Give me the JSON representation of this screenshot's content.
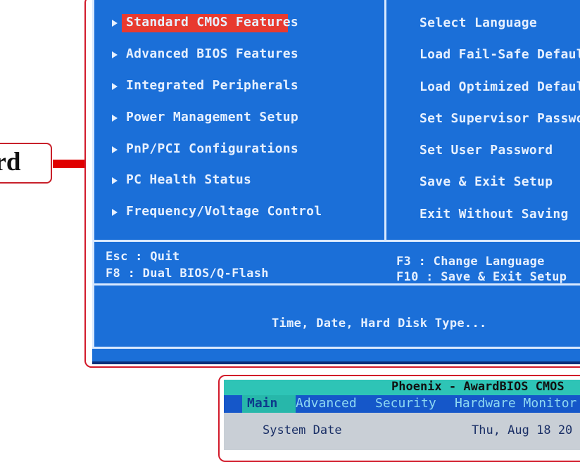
{
  "callout_label": "ard",
  "bios": {
    "left_menu": [
      "Standard CMOS Features",
      "Advanced BIOS Features",
      "Integrated Peripherals",
      "Power Management Setup",
      "PnP/PCI Configurations",
      "PC Health Status",
      "Frequency/Voltage Control"
    ],
    "right_menu": [
      "Select Language",
      "Load Fail-Safe Defaul",
      "Load Optimized Defaul",
      "Set Supervisor Passwor",
      "Set User Password",
      "Save & Exit Setup",
      "Exit Without Saving"
    ],
    "keys_left": [
      "Esc : Quit",
      "F8  : Dual BIOS/Q-Flash"
    ],
    "keys_right": [
      "F3  : Change Language",
      "F10 : Save & Exit Setup"
    ],
    "help_text": "Time, Date, Hard Disk Type...",
    "selected_index": 0,
    "colors": {
      "screen": "#1b6fd8",
      "selection": "#e83a2f",
      "text": "#e6f0ff"
    }
  },
  "bios2": {
    "title": "Phoenix - AwardBIOS CMOS",
    "tabs": [
      "Main",
      "Advanced",
      "Security",
      "Hardware Monitor"
    ],
    "row_label": "System Date",
    "row_value": "Thu, Aug 18 20"
  }
}
